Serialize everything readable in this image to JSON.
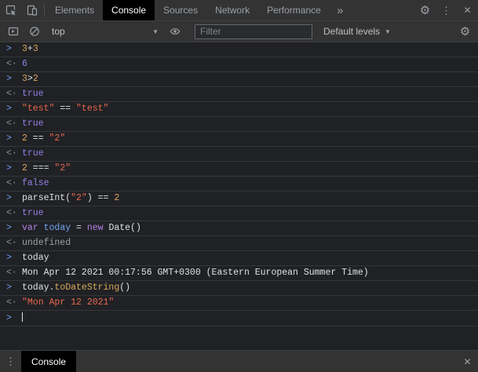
{
  "colors": {
    "background": "#202124",
    "toolbar_bg": "#333333",
    "border": "#3c4043",
    "row_border": "#34363a",
    "active_tab_bg": "#000000",
    "tab_text": "#9aa0a6",
    "text": "#dde1e6",
    "muted_text": "#9aa0a6",
    "accent_blue": "#6d9ef8",
    "result_arrow": "#8c9196",
    "token_number": "#dba55e",
    "token_string": "#e8684f",
    "token_result": "#9180e8",
    "token_keyword": "#b085e8",
    "token_variable": "#72a7f7",
    "token_property": "#d8a85e"
  },
  "icons": {
    "gear": "⚙",
    "kebab": "⋮",
    "close": "✕",
    "more_tabs": "»",
    "caret_down": "▼"
  },
  "top_bar": {
    "tabs": [
      {
        "label": "Elements",
        "active": false
      },
      {
        "label": "Console",
        "active": true
      },
      {
        "label": "Sources",
        "active": false
      },
      {
        "label": "Network",
        "active": false
      },
      {
        "label": "Performance",
        "active": false
      }
    ]
  },
  "toolbar": {
    "context_label": "top",
    "filter_placeholder": "Filter",
    "levels_label": "Default levels"
  },
  "console": {
    "input_mark": ">",
    "result_mark": "<·",
    "entries": [
      {
        "type": "input",
        "segments": [
          {
            "t": "n",
            "x": "3"
          },
          {
            "t": "p",
            "x": "+"
          },
          {
            "t": "n",
            "x": "3"
          }
        ]
      },
      {
        "type": "result",
        "segments": [
          {
            "t": "v",
            "x": "6"
          }
        ]
      },
      {
        "type": "input",
        "segments": [
          {
            "t": "n",
            "x": "3"
          },
          {
            "t": "p",
            "x": ">"
          },
          {
            "t": "n",
            "x": "2"
          }
        ]
      },
      {
        "type": "result",
        "segments": [
          {
            "t": "v",
            "x": "true"
          }
        ]
      },
      {
        "type": "input",
        "segments": [
          {
            "t": "s",
            "x": "\"test\""
          },
          {
            "t": "p",
            "x": " == "
          },
          {
            "t": "s",
            "x": "\"test\""
          }
        ]
      },
      {
        "type": "result",
        "segments": [
          {
            "t": "v",
            "x": "true"
          }
        ]
      },
      {
        "type": "input",
        "segments": [
          {
            "t": "n",
            "x": "2"
          },
          {
            "t": "p",
            "x": " == "
          },
          {
            "t": "s",
            "x": "\"2\""
          }
        ]
      },
      {
        "type": "result",
        "segments": [
          {
            "t": "v",
            "x": "true"
          }
        ]
      },
      {
        "type": "input",
        "segments": [
          {
            "t": "n",
            "x": "2"
          },
          {
            "t": "p",
            "x": " === "
          },
          {
            "t": "s",
            "x": "\"2\""
          }
        ]
      },
      {
        "type": "result",
        "segments": [
          {
            "t": "v",
            "x": "false"
          }
        ]
      },
      {
        "type": "input",
        "segments": [
          {
            "t": "p",
            "x": "parseInt("
          },
          {
            "t": "s",
            "x": "\"2\""
          },
          {
            "t": "p",
            "x": ") == "
          },
          {
            "t": "n",
            "x": "2"
          }
        ]
      },
      {
        "type": "result",
        "segments": [
          {
            "t": "v",
            "x": "true"
          }
        ]
      },
      {
        "type": "input",
        "segments": [
          {
            "t": "k",
            "x": "var "
          },
          {
            "t": "d",
            "x": "today"
          },
          {
            "t": "p",
            "x": " = "
          },
          {
            "t": "k",
            "x": "new "
          },
          {
            "t": "p",
            "x": "Date()"
          }
        ]
      },
      {
        "type": "result",
        "segments": [
          {
            "t": "m",
            "x": "undefined"
          }
        ]
      },
      {
        "type": "input",
        "segments": [
          {
            "t": "p",
            "x": "today"
          }
        ]
      },
      {
        "type": "result",
        "segments": [
          {
            "t": "p",
            "x": "Mon Apr 12 2021 00:17:56 GMT+0300 (Eastern European Summer Time)"
          }
        ]
      },
      {
        "type": "input",
        "segments": [
          {
            "t": "p",
            "x": "today."
          },
          {
            "t": "pr",
            "x": "toDateString"
          },
          {
            "t": "p",
            "x": "()"
          }
        ]
      },
      {
        "type": "result",
        "segments": [
          {
            "t": "s",
            "x": "\"Mon Apr 12 2021\""
          }
        ]
      },
      {
        "type": "prompt",
        "segments": [],
        "cursor": true
      }
    ]
  },
  "drawer": {
    "tab_label": "Console"
  }
}
